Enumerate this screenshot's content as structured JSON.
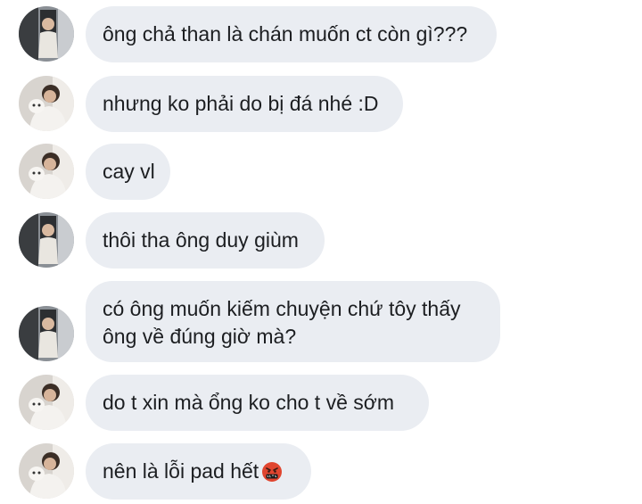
{
  "messages": [
    {
      "avatar": "avatar-a",
      "lines": [
        "ông chả than là chán muốn ct còn gì???"
      ]
    },
    {
      "avatar": "avatar-b",
      "lines": [
        "nhưng ko phải do bị đá nhé :D"
      ]
    },
    {
      "avatar": "avatar-b",
      "lines": [
        "cay vl"
      ]
    },
    {
      "avatar": "avatar-a",
      "lines": [
        "thôi tha ông duy giùm"
      ]
    },
    {
      "avatar": "avatar-a",
      "lines": [
        "có ông muốn kiếm chuyện chứ tôy thấy",
        "ông về đúng giờ mà?"
      ]
    },
    {
      "avatar": "avatar-b",
      "lines": [
        "do t xin mà ổng ko cho t về sớm"
      ]
    },
    {
      "avatar": "avatar-b",
      "lines": [
        "nên là lỗi pad hết"
      ],
      "emoji": "swearing-face-emoji"
    }
  ],
  "colors": {
    "bubble": "#eaedf2",
    "text": "#1c1e21",
    "emoji_face": "#e0452f"
  }
}
